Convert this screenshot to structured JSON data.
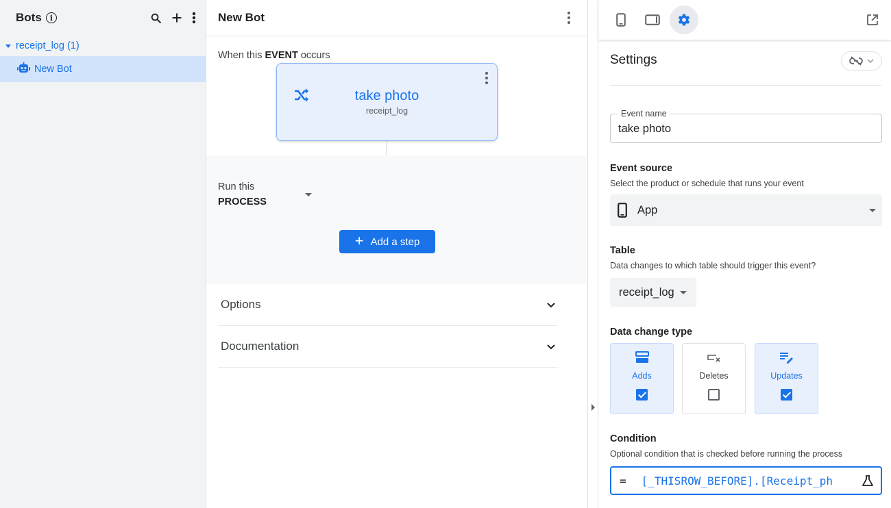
{
  "left": {
    "title": "Bots",
    "info_symbol": "i",
    "group_label": "receipt_log (1)",
    "bot_item_label": "New Bot"
  },
  "editor": {
    "title": "New Bot",
    "event_prefix": "When this ",
    "event_keyword": "EVENT",
    "event_suffix": " occurs",
    "event_card": {
      "title": "take photo",
      "subtitle": "receipt_log"
    },
    "process_line1": "Run this",
    "process_line2": "PROCESS",
    "add_step_plus": "+",
    "add_step_label": "Add a step",
    "accordions": [
      "Options",
      "Documentation"
    ]
  },
  "settings": {
    "title": "Settings",
    "event_name_label": "Event name",
    "event_name_value": "take photo",
    "event_source_title": "Event source",
    "event_source_sub": "Select the product or schedule that runs your event",
    "event_source_value": "App",
    "table_title": "Table",
    "table_sub": "Data changes to which table should trigger this event?",
    "table_value": "receipt_log",
    "data_change_title": "Data change type",
    "data_change_options": [
      {
        "label": "Adds",
        "checked": true
      },
      {
        "label": "Deletes",
        "checked": false
      },
      {
        "label": "Updates",
        "checked": true
      }
    ],
    "condition_title": "Condition",
    "condition_sub": "Optional condition that is checked before running the process",
    "condition_eq": "=",
    "condition_value": "[_THISROW_BEFORE].[Receipt_ph"
  },
  "colors": {
    "accent": "#1a73e8",
    "selected_bg": "#d2e3fc",
    "card_bg": "#e8f0fe"
  }
}
